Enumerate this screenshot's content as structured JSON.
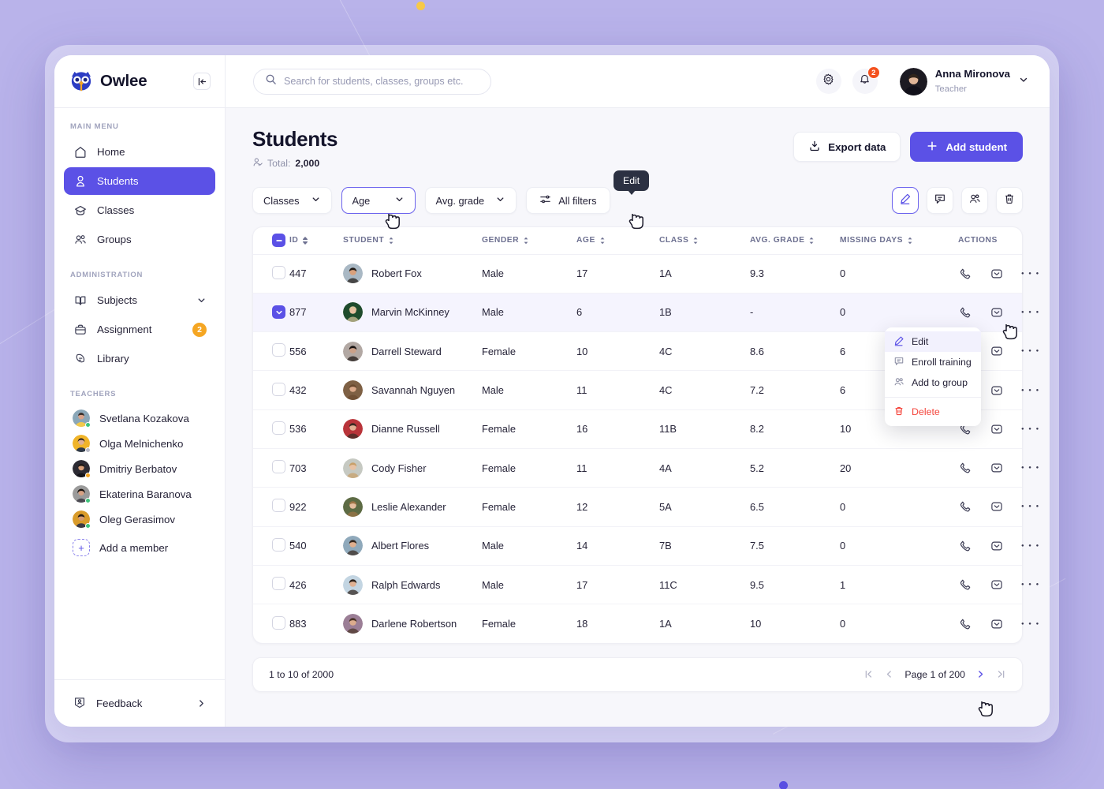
{
  "brand": {
    "name": "Owlee",
    "logo_icon": "owl-icon",
    "collapse_icon": "collapse-sidebar-icon"
  },
  "sidebar": {
    "main_menu_title": "MAIN MENU",
    "main_items": [
      {
        "label": "Home",
        "icon": "home-icon",
        "active": false
      },
      {
        "label": "Students",
        "icon": "user-icon",
        "active": true
      },
      {
        "label": "Classes",
        "icon": "graduation-cap-icon",
        "active": false
      },
      {
        "label": "Groups",
        "icon": "users-group-icon",
        "active": false
      }
    ],
    "administration_title": "ADMINISTRATION",
    "admin_items": [
      {
        "label": "Subjects",
        "icon": "book-icon",
        "trailing": "chevron-down-icon",
        "badge": ""
      },
      {
        "label": "Assignment",
        "icon": "briefcase-icon",
        "trailing": "",
        "badge": "2"
      },
      {
        "label": "Library",
        "icon": "library-icon",
        "trailing": "",
        "badge": ""
      }
    ],
    "teachers_title": "TEACHERS",
    "teachers": [
      {
        "name": "Svetlana Kozakova",
        "status": "#3fc47c",
        "skin": "#d9a38a",
        "hair": "#3b2f2a",
        "bg": "#8ba7b8"
      },
      {
        "name": "Olga Melnichenko",
        "status": "#b9bac6",
        "skin": "#e0b095",
        "hair": "#2a1f1b",
        "bg": "#f0b429"
      },
      {
        "name": "Dmitriy Berbatov",
        "status": "#f5a623",
        "skin": "#d9a07b",
        "hair": "#1d1714",
        "bg": "#2c2a33"
      },
      {
        "name": "Ekaterina Baranova",
        "status": "#3fc47c",
        "skin": "#d7a183",
        "hair": "#181310",
        "bg": "#9a9a9a"
      },
      {
        "name": "Oleg Gerasimov",
        "status": "#3fc47c",
        "skin": "#d49b73",
        "hair": "#221a14",
        "bg": "#d99b2a"
      }
    ],
    "add_member": {
      "label": "Add a member",
      "icon": "plus-box-icon"
    },
    "feedback": {
      "label": "Feedback",
      "icon": "feedback-icon",
      "trailing": "chevron-right-icon"
    }
  },
  "topbar": {
    "search_placeholder": "Search for students, classes, groups etc.",
    "search_value": "",
    "settings_icon": "gear-icon",
    "notifications_icon": "bell-icon",
    "notifications_count": "2",
    "user": {
      "name": "Anna Mironova",
      "role": "Teacher",
      "chevron": "chevron-down-icon"
    }
  },
  "page": {
    "title": "Students",
    "total_label": "Total:",
    "total_value": "2,000",
    "export_button": "Export data",
    "add_button": "Add student"
  },
  "filters": {
    "chips": [
      {
        "label": "Classes",
        "focused": false
      },
      {
        "label": "Age",
        "focused": true
      },
      {
        "label": "Avg. grade",
        "focused": false
      }
    ],
    "all_filters": "All filters",
    "tooltip": "Edit",
    "action_buttons": [
      {
        "name": "edit-icon",
        "active": true
      },
      {
        "name": "note-icon",
        "active": false
      },
      {
        "name": "add-to-group-icon",
        "active": false
      },
      {
        "name": "delete-icon",
        "active": false
      }
    ]
  },
  "table": {
    "columns": [
      {
        "label": "ID",
        "sortable": true
      },
      {
        "label": "STUDENT",
        "sortable": true
      },
      {
        "label": "GENDER",
        "sortable": true
      },
      {
        "label": "AGE",
        "sortable": true
      },
      {
        "label": "CLASS",
        "sortable": true
      },
      {
        "label": "AVG. GRADE",
        "sortable": true
      },
      {
        "label": "MISSING DAYS",
        "sortable": true
      },
      {
        "label": "ACTIONS",
        "sortable": false
      }
    ],
    "header_checkbox_state": "indeterminate",
    "rows": [
      {
        "id": "447",
        "student": "Robert Fox",
        "gender": "Male",
        "age": "17",
        "class": "1A",
        "grade": "9.3",
        "missing": "0",
        "selected": false,
        "skin": "#d9a07b",
        "hair": "#201a15",
        "bg": "#a9b8c4"
      },
      {
        "id": "877",
        "student": "Marvin McKinney",
        "gender": "Male",
        "age": "6",
        "class": "1B",
        "grade": "-",
        "missing": "0",
        "selected": true,
        "skin": "#e8c0a0",
        "hair": "#d8c49b",
        "bg": "#1f4b2c"
      },
      {
        "id": "556",
        "student": "Darrell Steward",
        "gender": "Female",
        "age": "10",
        "class": "4C",
        "grade": "8.6",
        "missing": "6",
        "selected": false,
        "skin": "#caa088",
        "hair": "#1a1412",
        "bg": "#b2a8a3"
      },
      {
        "id": "432",
        "student": "Savannah Nguyen",
        "gender": "Male",
        "age": "11",
        "class": "4C",
        "grade": "7.2",
        "missing": "6",
        "selected": false,
        "skin": "#dba98a",
        "hair": "#6b4a2f",
        "bg": "#7e6044"
      },
      {
        "id": "536",
        "student": "Dianne Russell",
        "gender": "Female",
        "age": "16",
        "class": "11B",
        "grade": "8.2",
        "missing": "10",
        "selected": false,
        "skin": "#e2b094",
        "hair": "#3a2a22",
        "bg": "#b9343a"
      },
      {
        "id": "703",
        "student": "Cody Fisher",
        "gender": "Female",
        "age": "11",
        "class": "4A",
        "grade": "5.2",
        "missing": "20",
        "selected": false,
        "skin": "#e8c2a4",
        "hair": "#c8a06a",
        "bg": "#c6c9c2"
      },
      {
        "id": "922",
        "student": "Leslie Alexander",
        "gender": "Female",
        "age": "12",
        "class": "5A",
        "grade": "6.5",
        "missing": "0",
        "selected": false,
        "skin": "#e5bd9e",
        "hair": "#9c7446",
        "bg": "#5d6b44"
      },
      {
        "id": "540",
        "student": "Albert Flores",
        "gender": "Male",
        "age": "14",
        "class": "7B",
        "grade": "7.5",
        "missing": "0",
        "selected": false,
        "skin": "#dfae8d",
        "hair": "#36281f",
        "bg": "#8fa9bb"
      },
      {
        "id": "426",
        "student": "Ralph Edwards",
        "gender": "Male",
        "age": "17",
        "class": "11C",
        "grade": "9.5",
        "missing": "1",
        "selected": false,
        "skin": "#e0b193",
        "hair": "#2e231c",
        "bg": "#c3d5e2"
      },
      {
        "id": "883",
        "student": "Darlene Robertson",
        "gender": "Female",
        "age": "18",
        "class": "1A",
        "grade": "10",
        "missing": "0",
        "selected": false,
        "skin": "#dcac8d",
        "hair": "#4a3326",
        "bg": "#9b7e96"
      }
    ],
    "row_actions": {
      "call_icon": "phone-icon",
      "mail_icon": "envelope-icon",
      "more_icon": "more-horizontal-icon"
    }
  },
  "context_menu": {
    "items": [
      {
        "label": "Edit",
        "icon": "pencil-icon",
        "danger": false,
        "hover": true
      },
      {
        "label": "Enroll training",
        "icon": "note-icon",
        "danger": false,
        "hover": false
      },
      {
        "label": "Add to group",
        "icon": "users-group-icon",
        "danger": false,
        "hover": false
      },
      {
        "label": "Delete",
        "icon": "trash-icon",
        "danger": true,
        "hover": false
      }
    ]
  },
  "pagination": {
    "range_text": "1 to 10 of 2000",
    "page_label": "Page 1 of 200",
    "first_icon": "first-page-icon",
    "prev_icon": "prev-page-icon",
    "next_icon": "next-page-icon",
    "last_icon": "last-page-icon"
  },
  "colors": {
    "accent": "#5b51e6",
    "background": "#b9b3ea",
    "danger": "#f4453c",
    "warning": "#f5a623",
    "notification": "#f4511e",
    "tooltip_bg": "#2c3142"
  }
}
